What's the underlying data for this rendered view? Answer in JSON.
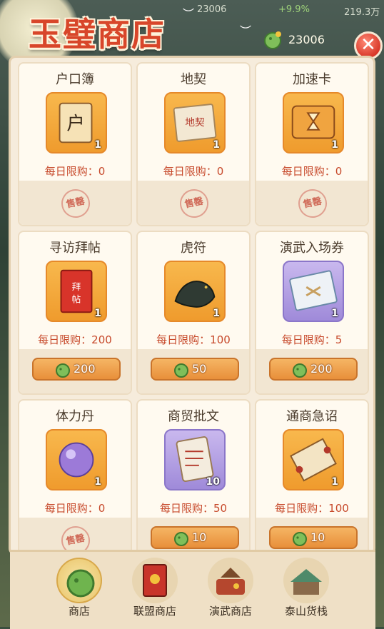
{
  "title": "玉璧商店",
  "currency": {
    "amount": "23006",
    "icon": "jade-coin-icon"
  },
  "topbar": {
    "value": "23006",
    "rate": "+9.9%",
    "power": "219.3万"
  },
  "close_label": "✕",
  "items": [
    {
      "name": "户口簿",
      "qty": "1",
      "limit": "每日限购：0",
      "price": null,
      "stamp": "售罄",
      "icon": "registry-book-icon",
      "slot": "orange"
    },
    {
      "name": "地契",
      "qty": "1",
      "limit": "每日限购：0",
      "price": null,
      "stamp": "售罄",
      "icon": "land-deed-icon",
      "slot": "orange"
    },
    {
      "name": "加速卡",
      "qty": "1",
      "limit": "每日限购：0",
      "price": null,
      "stamp": "售罄",
      "icon": "hourglass-card-icon",
      "slot": "orange"
    },
    {
      "name": "寻访拜帖",
      "qty": "1",
      "limit": "每日限购：200",
      "price": "200",
      "stamp": null,
      "icon": "visit-invitation-icon",
      "slot": "orange"
    },
    {
      "name": "虎符",
      "qty": "1",
      "limit": "每日限购：100",
      "price": "50",
      "stamp": null,
      "icon": "tiger-tally-icon",
      "slot": "orange"
    },
    {
      "name": "演武入场券",
      "qty": "1",
      "limit": "每日限购：5",
      "price": "200",
      "stamp": null,
      "icon": "arena-ticket-icon",
      "slot": "purple"
    },
    {
      "name": "体力丹",
      "qty": "1",
      "limit": "每日限购：0",
      "price": null,
      "stamp": "售罄",
      "icon": "stamina-pill-icon",
      "slot": "orange"
    },
    {
      "name": "商贸批文",
      "qty": "10",
      "limit": "每日限购：50",
      "price": "10",
      "stamp": null,
      "icon": "trade-permit-icon",
      "slot": "purple"
    },
    {
      "name": "通商急诏",
      "qty": "1",
      "limit": "每日限购：100",
      "price": "10",
      "stamp": null,
      "icon": "trade-edict-icon",
      "slot": "orange"
    }
  ],
  "nav": [
    {
      "label": "商店",
      "icon": "jade-shop-icon",
      "active": true
    },
    {
      "label": "联盟商店",
      "icon": "alliance-banner-icon",
      "active": false
    },
    {
      "label": "演武商店",
      "icon": "arena-shop-icon",
      "active": false
    },
    {
      "label": "泰山货栈",
      "icon": "mountain-stall-icon",
      "active": false
    }
  ]
}
